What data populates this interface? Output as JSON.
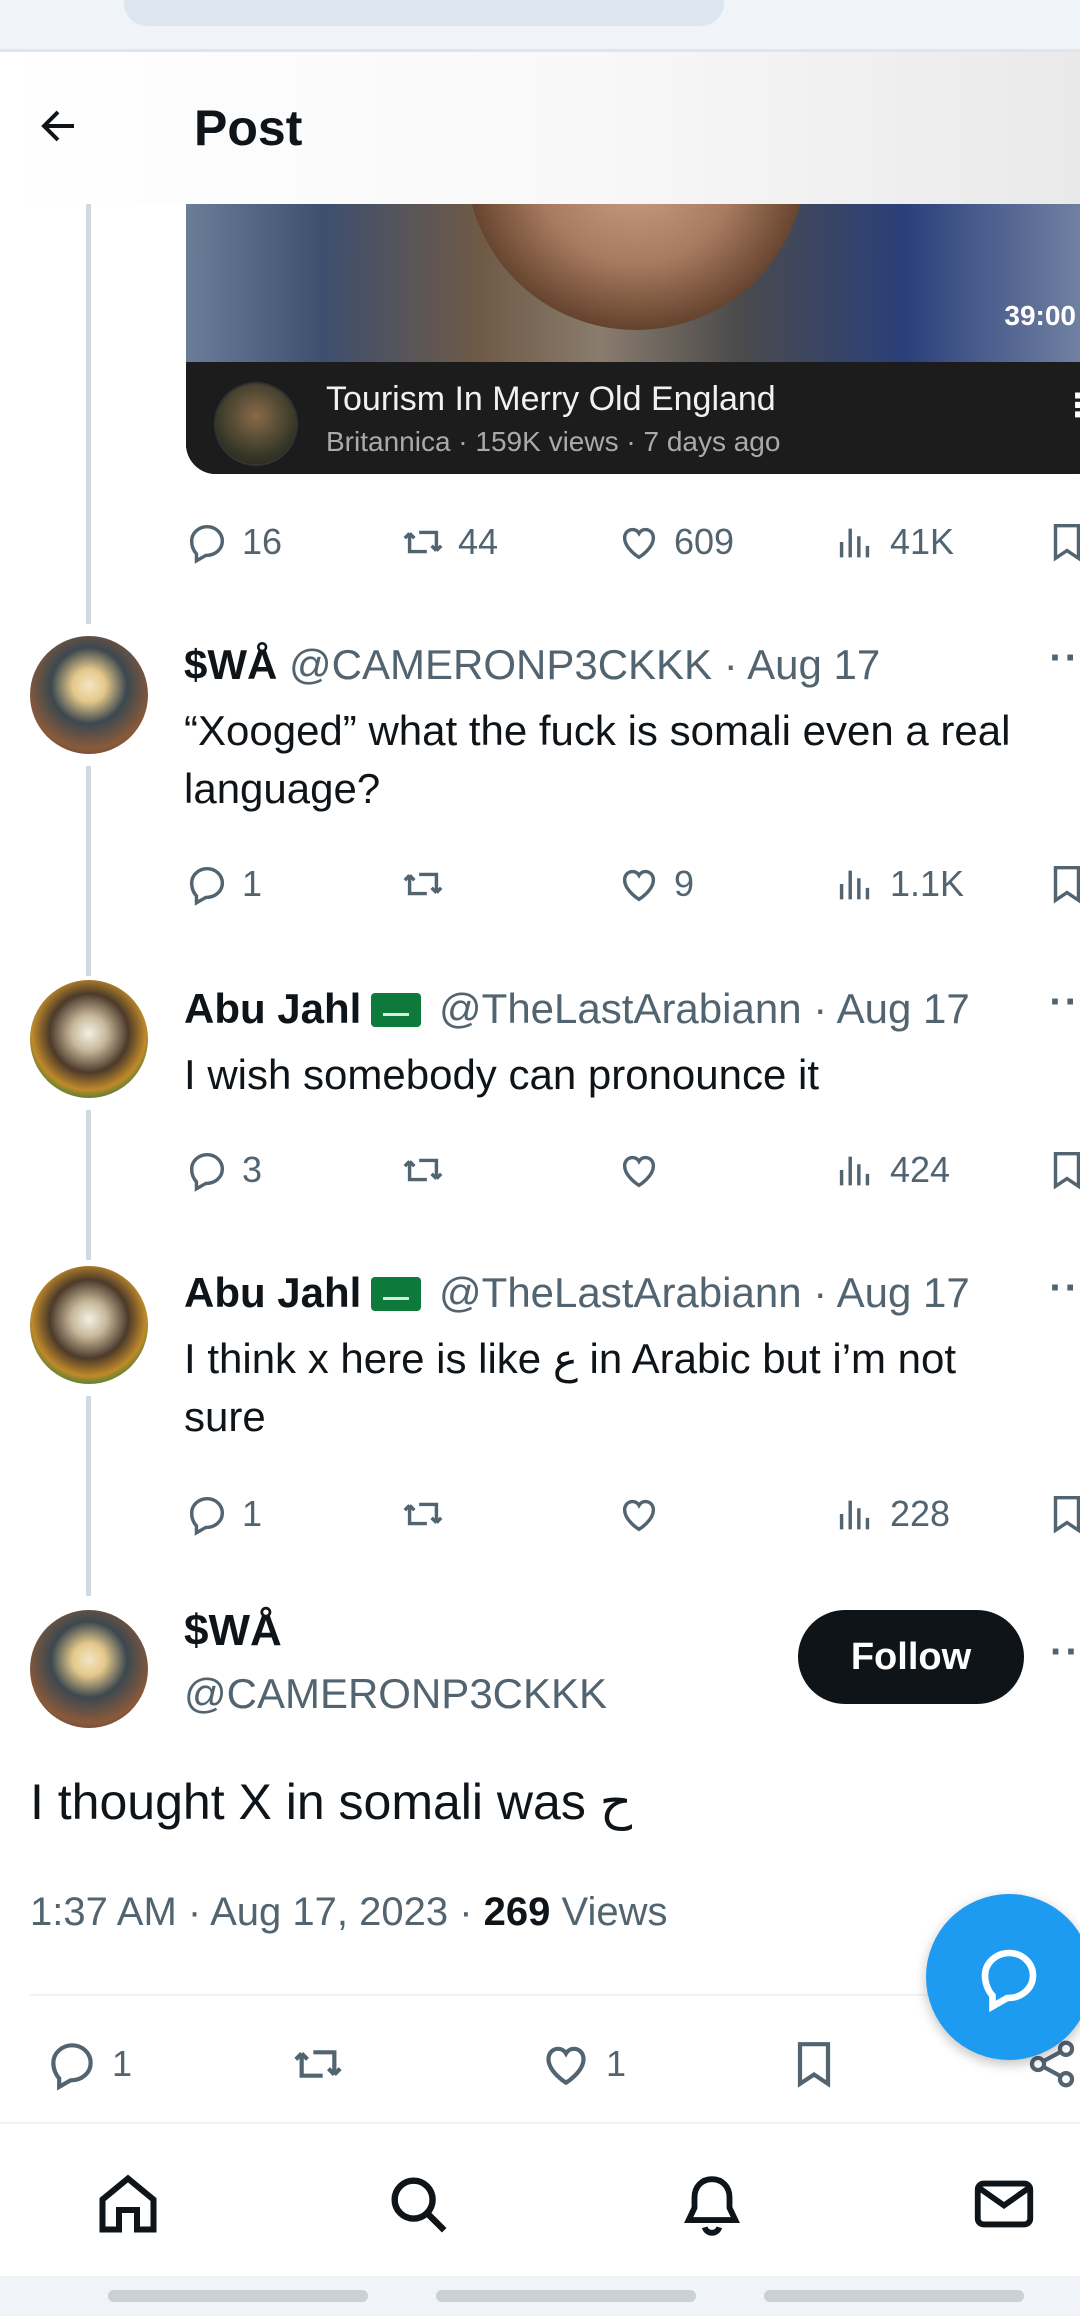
{
  "header": {
    "title": "Post"
  },
  "video": {
    "duration": "39:00",
    "title": "Tourism In Merry Old England",
    "subtitle": "Britannica · 159K views · 7 days ago"
  },
  "parent_actions": {
    "replies": "16",
    "reposts": "44",
    "likes": "609",
    "views": "41K"
  },
  "replies": [
    {
      "name": "$WÅ",
      "handle": "@CAMERONP3CKKK",
      "date": "Aug 17",
      "verified_flag": false,
      "text_line1": "“Xooged” what the fuck is somali even a real",
      "text_line2": "language?",
      "actions": {
        "replies": "1",
        "reposts": "",
        "likes": "9",
        "views": "1.1K"
      }
    },
    {
      "name": "Abu Jahl",
      "handle": "@TheLastArabiann",
      "date": "Aug 17",
      "verified_flag": true,
      "text_line1": "I wish somebody can pronounce it",
      "text_line2": "",
      "actions": {
        "replies": "3",
        "reposts": "",
        "likes": "",
        "views": "424"
      }
    },
    {
      "name": "Abu Jahl",
      "handle": "@TheLastArabiann",
      "date": "Aug 17",
      "verified_flag": true,
      "text_line1": "I think x here is like ع in Arabic but i’m not",
      "text_line2": "sure",
      "actions": {
        "replies": "1",
        "reposts": "",
        "likes": "",
        "views": "228"
      }
    }
  ],
  "main_post": {
    "name": "$WÅ",
    "handle": "@CAMERONP3CKKK",
    "follow_label": "Follow",
    "text": "I thought X in somali was ح",
    "time": "1:37 AM · Aug 17, 2023 · ",
    "views_count": "269",
    "views_label": " Views",
    "actions": {
      "replies": "1",
      "likes": "1"
    }
  },
  "icons": [
    "back-arrow-icon",
    "reply-icon",
    "repost-icon",
    "like-icon",
    "views-icon",
    "bookmark-icon",
    "share-icon",
    "compose-reply-icon",
    "home-icon",
    "search-icon",
    "notifications-icon",
    "messages-icon"
  ],
  "colors": {
    "accent": "#1d9bf0",
    "text": "#0f1419",
    "muted": "#536471",
    "line": "#cfd9de"
  }
}
